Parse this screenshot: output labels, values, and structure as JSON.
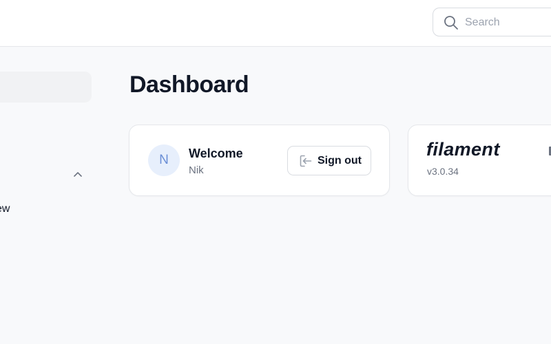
{
  "header": {
    "search": {
      "placeholder": "Search",
      "icon": "search-icon"
    }
  },
  "sidebar": {
    "group_toggle_icon": "chevron-up-icon",
    "items": [
      {
        "label": "ew"
      }
    ]
  },
  "page": {
    "title": "Dashboard"
  },
  "widgets": {
    "account": {
      "avatar_initial": "N",
      "title": "Welcome",
      "user_name": "Nik",
      "sign_out_label": "Sign out",
      "sign_out_icon": "sign-out-icon"
    },
    "filament_info": {
      "brand": "filament",
      "version": "v3.0.34"
    }
  },
  "colors": {
    "background": "#f8f9fb",
    "card": "#ffffff",
    "border": "#e5e7eb",
    "avatar_bg": "#e7effc",
    "avatar_text": "#6b8fd6",
    "muted_text": "#6b7280"
  }
}
